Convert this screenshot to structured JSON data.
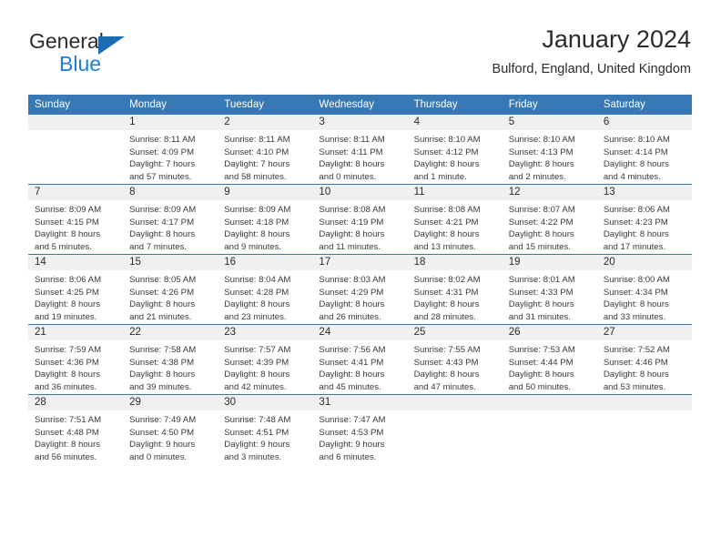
{
  "brand": {
    "name_part1": "General",
    "name_part2": "Blue"
  },
  "header": {
    "title": "January 2024",
    "subtitle": "Bulford, England, United Kingdom"
  },
  "colors": {
    "header_blue": "#3878b4",
    "brand_blue": "#1b7fd4",
    "daynum_bg": "#f0f0f0"
  },
  "weekday_headers": [
    "Sunday",
    "Monday",
    "Tuesday",
    "Wednesday",
    "Thursday",
    "Friday",
    "Saturday"
  ],
  "weeks": [
    [
      {
        "day": "",
        "sunrise": "",
        "sunset": "",
        "daylight_1": "",
        "daylight_2": ""
      },
      {
        "day": "1",
        "sunrise": "Sunrise: 8:11 AM",
        "sunset": "Sunset: 4:09 PM",
        "daylight_1": "Daylight: 7 hours",
        "daylight_2": "and 57 minutes."
      },
      {
        "day": "2",
        "sunrise": "Sunrise: 8:11 AM",
        "sunset": "Sunset: 4:10 PM",
        "daylight_1": "Daylight: 7 hours",
        "daylight_2": "and 58 minutes."
      },
      {
        "day": "3",
        "sunrise": "Sunrise: 8:11 AM",
        "sunset": "Sunset: 4:11 PM",
        "daylight_1": "Daylight: 8 hours",
        "daylight_2": "and 0 minutes."
      },
      {
        "day": "4",
        "sunrise": "Sunrise: 8:10 AM",
        "sunset": "Sunset: 4:12 PM",
        "daylight_1": "Daylight: 8 hours",
        "daylight_2": "and 1 minute."
      },
      {
        "day": "5",
        "sunrise": "Sunrise: 8:10 AM",
        "sunset": "Sunset: 4:13 PM",
        "daylight_1": "Daylight: 8 hours",
        "daylight_2": "and 2 minutes."
      },
      {
        "day": "6",
        "sunrise": "Sunrise: 8:10 AM",
        "sunset": "Sunset: 4:14 PM",
        "daylight_1": "Daylight: 8 hours",
        "daylight_2": "and 4 minutes."
      }
    ],
    [
      {
        "day": "7",
        "sunrise": "Sunrise: 8:09 AM",
        "sunset": "Sunset: 4:15 PM",
        "daylight_1": "Daylight: 8 hours",
        "daylight_2": "and 5 minutes."
      },
      {
        "day": "8",
        "sunrise": "Sunrise: 8:09 AM",
        "sunset": "Sunset: 4:17 PM",
        "daylight_1": "Daylight: 8 hours",
        "daylight_2": "and 7 minutes."
      },
      {
        "day": "9",
        "sunrise": "Sunrise: 8:09 AM",
        "sunset": "Sunset: 4:18 PM",
        "daylight_1": "Daylight: 8 hours",
        "daylight_2": "and 9 minutes."
      },
      {
        "day": "10",
        "sunrise": "Sunrise: 8:08 AM",
        "sunset": "Sunset: 4:19 PM",
        "daylight_1": "Daylight: 8 hours",
        "daylight_2": "and 11 minutes."
      },
      {
        "day": "11",
        "sunrise": "Sunrise: 8:08 AM",
        "sunset": "Sunset: 4:21 PM",
        "daylight_1": "Daylight: 8 hours",
        "daylight_2": "and 13 minutes."
      },
      {
        "day": "12",
        "sunrise": "Sunrise: 8:07 AM",
        "sunset": "Sunset: 4:22 PM",
        "daylight_1": "Daylight: 8 hours",
        "daylight_2": "and 15 minutes."
      },
      {
        "day": "13",
        "sunrise": "Sunrise: 8:06 AM",
        "sunset": "Sunset: 4:23 PM",
        "daylight_1": "Daylight: 8 hours",
        "daylight_2": "and 17 minutes."
      }
    ],
    [
      {
        "day": "14",
        "sunrise": "Sunrise: 8:06 AM",
        "sunset": "Sunset: 4:25 PM",
        "daylight_1": "Daylight: 8 hours",
        "daylight_2": "and 19 minutes."
      },
      {
        "day": "15",
        "sunrise": "Sunrise: 8:05 AM",
        "sunset": "Sunset: 4:26 PM",
        "daylight_1": "Daylight: 8 hours",
        "daylight_2": "and 21 minutes."
      },
      {
        "day": "16",
        "sunrise": "Sunrise: 8:04 AM",
        "sunset": "Sunset: 4:28 PM",
        "daylight_1": "Daylight: 8 hours",
        "daylight_2": "and 23 minutes."
      },
      {
        "day": "17",
        "sunrise": "Sunrise: 8:03 AM",
        "sunset": "Sunset: 4:29 PM",
        "daylight_1": "Daylight: 8 hours",
        "daylight_2": "and 26 minutes."
      },
      {
        "day": "18",
        "sunrise": "Sunrise: 8:02 AM",
        "sunset": "Sunset: 4:31 PM",
        "daylight_1": "Daylight: 8 hours",
        "daylight_2": "and 28 minutes."
      },
      {
        "day": "19",
        "sunrise": "Sunrise: 8:01 AM",
        "sunset": "Sunset: 4:33 PM",
        "daylight_1": "Daylight: 8 hours",
        "daylight_2": "and 31 minutes."
      },
      {
        "day": "20",
        "sunrise": "Sunrise: 8:00 AM",
        "sunset": "Sunset: 4:34 PM",
        "daylight_1": "Daylight: 8 hours",
        "daylight_2": "and 33 minutes."
      }
    ],
    [
      {
        "day": "21",
        "sunrise": "Sunrise: 7:59 AM",
        "sunset": "Sunset: 4:36 PM",
        "daylight_1": "Daylight: 8 hours",
        "daylight_2": "and 36 minutes."
      },
      {
        "day": "22",
        "sunrise": "Sunrise: 7:58 AM",
        "sunset": "Sunset: 4:38 PM",
        "daylight_1": "Daylight: 8 hours",
        "daylight_2": "and 39 minutes."
      },
      {
        "day": "23",
        "sunrise": "Sunrise: 7:57 AM",
        "sunset": "Sunset: 4:39 PM",
        "daylight_1": "Daylight: 8 hours",
        "daylight_2": "and 42 minutes."
      },
      {
        "day": "24",
        "sunrise": "Sunrise: 7:56 AM",
        "sunset": "Sunset: 4:41 PM",
        "daylight_1": "Daylight: 8 hours",
        "daylight_2": "and 45 minutes."
      },
      {
        "day": "25",
        "sunrise": "Sunrise: 7:55 AM",
        "sunset": "Sunset: 4:43 PM",
        "daylight_1": "Daylight: 8 hours",
        "daylight_2": "and 47 minutes."
      },
      {
        "day": "26",
        "sunrise": "Sunrise: 7:53 AM",
        "sunset": "Sunset: 4:44 PM",
        "daylight_1": "Daylight: 8 hours",
        "daylight_2": "and 50 minutes."
      },
      {
        "day": "27",
        "sunrise": "Sunrise: 7:52 AM",
        "sunset": "Sunset: 4:46 PM",
        "daylight_1": "Daylight: 8 hours",
        "daylight_2": "and 53 minutes."
      }
    ],
    [
      {
        "day": "28",
        "sunrise": "Sunrise: 7:51 AM",
        "sunset": "Sunset: 4:48 PM",
        "daylight_1": "Daylight: 8 hours",
        "daylight_2": "and 56 minutes."
      },
      {
        "day": "29",
        "sunrise": "Sunrise: 7:49 AM",
        "sunset": "Sunset: 4:50 PM",
        "daylight_1": "Daylight: 9 hours",
        "daylight_2": "and 0 minutes."
      },
      {
        "day": "30",
        "sunrise": "Sunrise: 7:48 AM",
        "sunset": "Sunset: 4:51 PM",
        "daylight_1": "Daylight: 9 hours",
        "daylight_2": "and 3 minutes."
      },
      {
        "day": "31",
        "sunrise": "Sunrise: 7:47 AM",
        "sunset": "Sunset: 4:53 PM",
        "daylight_1": "Daylight: 9 hours",
        "daylight_2": "and 6 minutes."
      },
      {
        "day": "",
        "sunrise": "",
        "sunset": "",
        "daylight_1": "",
        "daylight_2": ""
      },
      {
        "day": "",
        "sunrise": "",
        "sunset": "",
        "daylight_1": "",
        "daylight_2": ""
      },
      {
        "day": "",
        "sunrise": "",
        "sunset": "",
        "daylight_1": "",
        "daylight_2": ""
      }
    ]
  ]
}
